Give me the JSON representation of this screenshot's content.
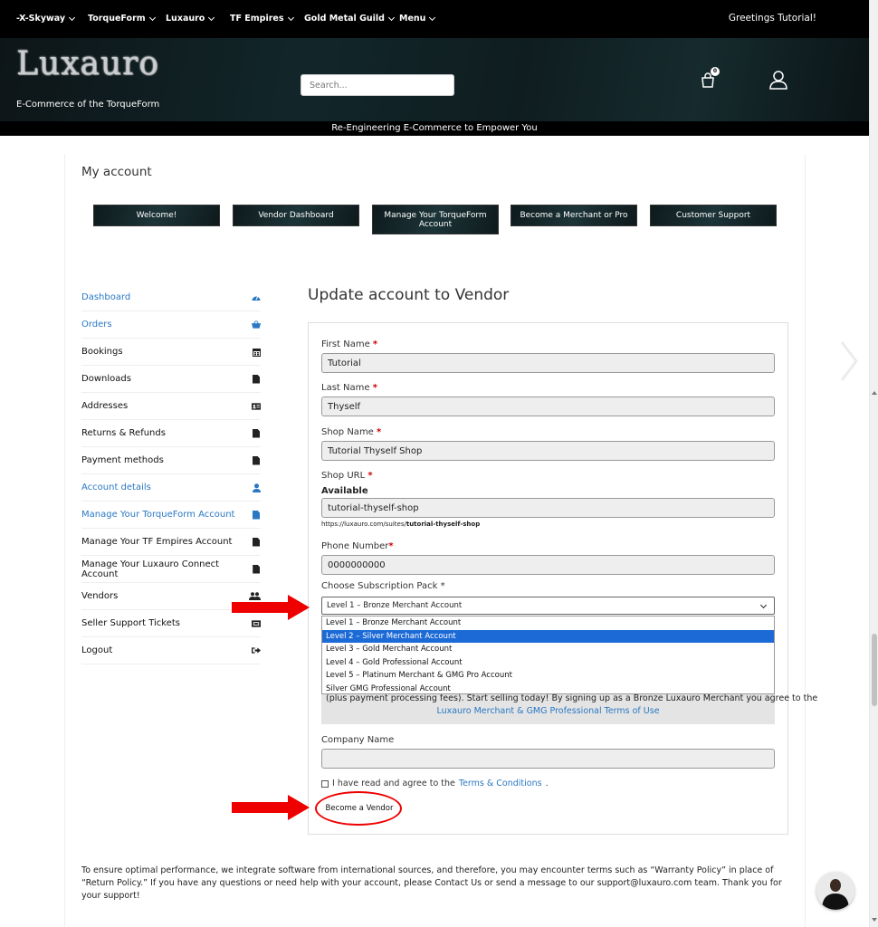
{
  "nav": {
    "items": [
      "-X-Skyway",
      "TorqueForm",
      "Luxauro",
      "TF Empires",
      "Gold Metal Guild",
      "Menu"
    ],
    "greeting": "Greetings Tutorial!"
  },
  "header": {
    "logo": "Luxauro",
    "tagline": "E-Commerce of the TorqueForm",
    "search_placeholder": "Search...",
    "cart_count": "0",
    "banner": "Re-Engineering E-Commerce to Empower You"
  },
  "page": {
    "title": "My account",
    "tabs": [
      "Welcome!",
      "Vendor Dashboard",
      "Manage Your TorqueForm Account",
      "Become a Merchant or Pro",
      "Customer Support"
    ]
  },
  "sidebar": {
    "items": [
      {
        "label": "Dashboard",
        "icon": "gauge-icon"
      },
      {
        "label": "Orders",
        "icon": "basket-icon"
      },
      {
        "label": "Bookings",
        "icon": "calendar-icon"
      },
      {
        "label": "Downloads",
        "icon": "document-icon"
      },
      {
        "label": "Addresses",
        "icon": "id-card-icon"
      },
      {
        "label": "Returns & Refunds",
        "icon": "document-icon"
      },
      {
        "label": "Payment methods",
        "icon": "document-icon"
      },
      {
        "label": "Account details",
        "icon": "user-icon"
      },
      {
        "label": "Manage Your TorqueForm Account",
        "icon": "document-icon"
      },
      {
        "label": "Manage Your TF Empires Account",
        "icon": "document-icon"
      },
      {
        "label": "Manage Your Luxauro Connect Account",
        "icon": "document-icon"
      },
      {
        "label": "Vendors",
        "icon": "users-icon"
      },
      {
        "label": "Seller Support Tickets",
        "icon": "ticket-icon"
      },
      {
        "label": "Logout",
        "icon": "logout-icon"
      }
    ]
  },
  "form": {
    "heading": "Update account to Vendor",
    "first_name_label": "First Name",
    "first_name": "Tutorial",
    "last_name_label": "Last Name",
    "last_name": "Thyself",
    "shop_name_label": "Shop Name",
    "shop_name": "Tutorial Thyself Shop",
    "shop_url_label": "Shop URL",
    "shop_url_status": "Available",
    "shop_url": "tutorial-thyself-shop",
    "shop_url_prefix": "https://luxauro.com/suites/",
    "phone_label": "Phone Number",
    "phone": "0000000000",
    "subscription_label": "Choose Subscription Pack",
    "required_mark": "*",
    "subscription_selected": "Level 1 – Bronze Merchant Account",
    "subscription_options": [
      "Level 1 – Bronze Merchant Account",
      "Level 2 – Silver Merchant Account",
      "Level 3 – Gold Merchant Account",
      "Level 4 – Gold Professional Account",
      "Level 5 – Platinum Merchant & GMG Pro Account",
      "Silver GMG Professional Account"
    ],
    "description_line": "(plus payment processing fees). Start selling today! By signing up as a Bronze Luxauro Merchant you agree to the",
    "description_link": "Luxauro Merchant & GMG Professional Terms of Use",
    "company_label": "Company Name",
    "company": "",
    "agree_text": "I have read and agree to the",
    "agree_link": "Terms & Conditions",
    "submit": "Become a Vendor"
  },
  "footer": {
    "note": "To ensure optimal performance, we integrate software from international sources, and therefore, you may encounter terms such as “Warranty Policy” in place of “Return Policy.” If you have any questions or need help with your account, please Contact Us or send a message to our support@luxauro.com team. Thank you for your support!"
  },
  "colors": {
    "link": "#2a78c3",
    "annotation": "#e00000",
    "selected_option": "#1c6ad6"
  }
}
